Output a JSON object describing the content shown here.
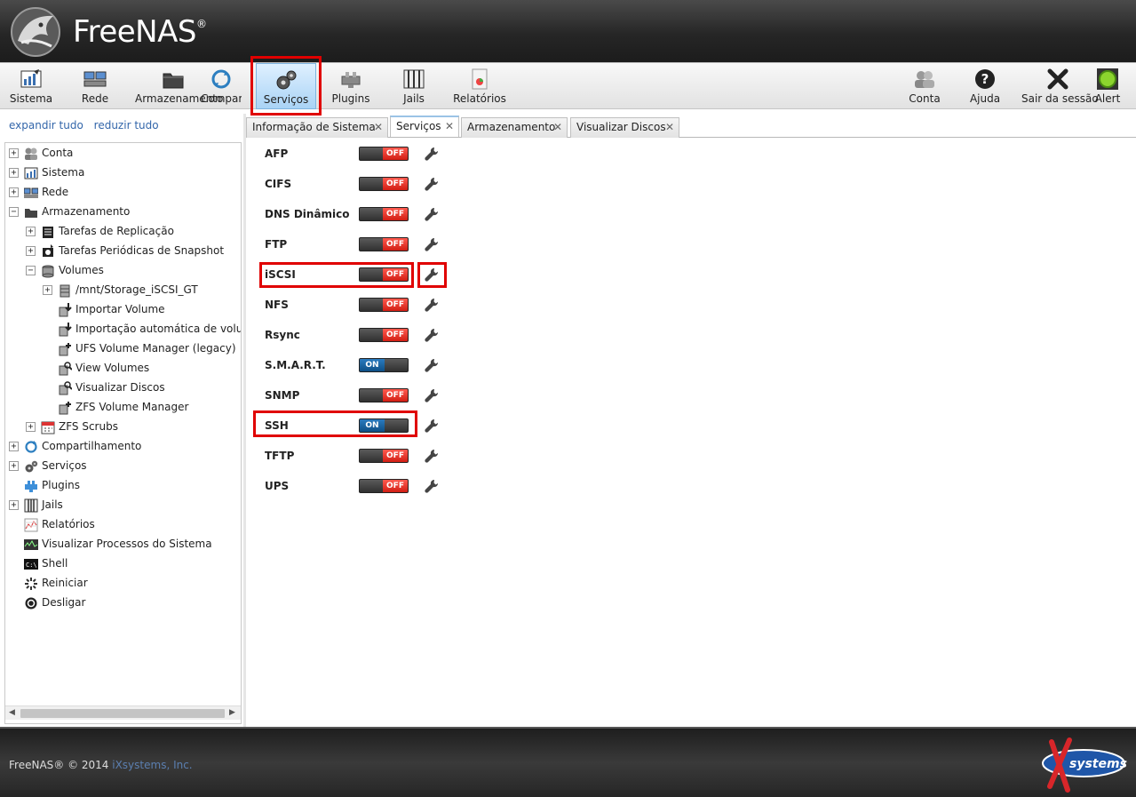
{
  "header": {
    "brand": "FreeNAS",
    "registered": "®"
  },
  "toolbar": {
    "left": [
      {
        "label": "Sistema",
        "icon": "system-icon"
      },
      {
        "label": "Rede",
        "icon": "network-icon"
      },
      {
        "label": "Armazenamento",
        "icon": "storage-icon"
      },
      {
        "label": "Compartilhamento",
        "icon": "sharing-icon"
      },
      {
        "label": "Serviços",
        "icon": "services-icon",
        "active": true
      },
      {
        "label": "Plugins",
        "icon": "plugins-icon"
      },
      {
        "label": "Jails",
        "icon": "jails-icon"
      },
      {
        "label": "Relatórios",
        "icon": "reports-icon"
      }
    ],
    "right": [
      {
        "label": "Conta",
        "icon": "account-icon"
      },
      {
        "label": "Ajuda",
        "icon": "help-icon"
      },
      {
        "label": "Sair da sessão",
        "icon": "logout-icon"
      },
      {
        "label": "Alert",
        "icon": "alert-icon"
      }
    ]
  },
  "sidebar": {
    "expand_all": "expandir tudo",
    "collapse_all": "reduzir tudo",
    "tree": [
      {
        "label": "Conta",
        "expander": "+",
        "icon": "account-icon"
      },
      {
        "label": "Sistema",
        "expander": "+",
        "icon": "system-icon"
      },
      {
        "label": "Rede",
        "expander": "+",
        "icon": "network-icon"
      },
      {
        "label": "Armazenamento",
        "expander": "−",
        "icon": "folder-icon"
      },
      {
        "label": "Tarefas de Replicação",
        "expander": "+",
        "icon": "replication-icon"
      },
      {
        "label": "Tarefas Periódicas de Snapshot",
        "expander": "+",
        "icon": "snapshot-icon"
      },
      {
        "label": "Volumes",
        "expander": "−",
        "icon": "volumes-icon"
      },
      {
        "label": "/mnt/Storage_iSCSI_GT",
        "expander": "+",
        "icon": "volume-icon"
      },
      {
        "label": "Importar Volume",
        "expander": "",
        "icon": "import-volume-icon"
      },
      {
        "label": "Importação automática de volume",
        "expander": "",
        "icon": "auto-import-icon"
      },
      {
        "label": "UFS Volume Manager (legacy)",
        "expander": "",
        "icon": "ufs-manager-icon"
      },
      {
        "label": "View Volumes",
        "expander": "",
        "icon": "view-volumes-icon"
      },
      {
        "label": "Visualizar Discos",
        "expander": "",
        "icon": "view-disks-icon"
      },
      {
        "label": "ZFS Volume Manager",
        "expander": "",
        "icon": "zfs-manager-icon"
      },
      {
        "label": "ZFS Scrubs",
        "expander": "+",
        "icon": "calendar-icon"
      },
      {
        "label": "Compartilhamento",
        "expander": "+",
        "icon": "sharing-icon"
      },
      {
        "label": "Serviços",
        "expander": "+",
        "icon": "services-icon"
      },
      {
        "label": "Plugins",
        "expander": "",
        "icon": "plugins-icon"
      },
      {
        "label": "Jails",
        "expander": "+",
        "icon": "jails-icon"
      },
      {
        "label": "Relatórios",
        "expander": "",
        "icon": "reports-icon"
      },
      {
        "label": "Visualizar Processos do Sistema",
        "expander": "",
        "icon": "processes-icon"
      },
      {
        "label": "Shell",
        "expander": "",
        "icon": "shell-icon"
      },
      {
        "label": "Reiniciar",
        "expander": "",
        "icon": "reboot-icon"
      },
      {
        "label": "Desligar",
        "expander": "",
        "icon": "shutdown-icon"
      }
    ]
  },
  "tabs": [
    {
      "label": "Informação de Sistema",
      "close": "✕"
    },
    {
      "label": "Serviços",
      "close": "✕",
      "active": true
    },
    {
      "label": "Armazenamento",
      "close": "✕"
    },
    {
      "label": "Visualizar Discos",
      "close": "✕"
    }
  ],
  "services": [
    {
      "name": "AFP",
      "state": "OFF"
    },
    {
      "name": "CIFS",
      "state": "OFF"
    },
    {
      "name": "DNS Dinâmico",
      "state": "OFF"
    },
    {
      "name": "FTP",
      "state": "OFF"
    },
    {
      "name": "iSCSI",
      "state": "OFF"
    },
    {
      "name": "NFS",
      "state": "OFF"
    },
    {
      "name": "Rsync",
      "state": "OFF"
    },
    {
      "name": "S.M.A.R.T.",
      "state": "ON"
    },
    {
      "name": "SNMP",
      "state": "OFF"
    },
    {
      "name": "SSH",
      "state": "ON"
    },
    {
      "name": "TFTP",
      "state": "OFF"
    },
    {
      "name": "UPS",
      "state": "OFF"
    }
  ],
  "footer": {
    "copyright": "FreeNAS® © 2014 ",
    "company": "iXsystems, Inc.",
    "logo_text": "systems"
  },
  "colors": {
    "highlight": "#e00000",
    "toggle_off": "#e0281e",
    "toggle_on": "#155a94",
    "link": "#3366aa"
  }
}
